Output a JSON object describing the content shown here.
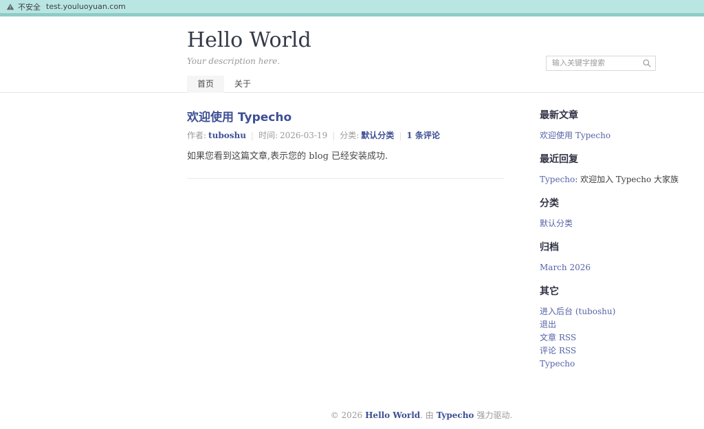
{
  "browser": {
    "security_label": "不安全",
    "url": "test.youluoyuan.com"
  },
  "header": {
    "site_title": "Hello World",
    "description": "Your description here.",
    "nav_items": [
      "首页",
      "关于"
    ],
    "search_placeholder": "输入关键字搜索"
  },
  "post": {
    "title": "欢迎使用 Typecho",
    "author_label": "作者:",
    "author": "tuboshu",
    "time_label": "时间:",
    "date": "2026-03-19",
    "category_label": "分类:",
    "category": "默认分类",
    "comments": "1 条评论",
    "separator": "|",
    "body": "如果您看到这篇文章,表示您的 blog 已经安装成功."
  },
  "sidebar": {
    "latest_posts": {
      "title": "最新文章",
      "items": [
        "欢迎使用 Typecho"
      ]
    },
    "recent_replies": {
      "title": "最近回复",
      "author": "Typecho",
      "excerpt": ": 欢迎加入 Typecho 大家族"
    },
    "categories": {
      "title": "分类",
      "items": [
        "默认分类"
      ]
    },
    "archives": {
      "title": "归档",
      "items": [
        "March 2026"
      ]
    },
    "misc": {
      "title": "其它",
      "items": [
        "进入后台 (tuboshu)",
        "退出",
        "文章 RSS",
        "评论 RSS",
        "Typecho"
      ]
    }
  },
  "footer": {
    "copyright": "© 2026",
    "site_name": "Hello World",
    "powered_prefix": ". 由",
    "engine": "Typecho",
    "powered_suffix": "强力驱动."
  },
  "colors": {
    "topbar-bg": "#b9e5e2",
    "topbar-strip": "#8fcbc7",
    "accent": "#3d4f95",
    "link": "#5663a7",
    "heading": "#343848",
    "text": "#474747",
    "muted": "#9a9a9a",
    "border": "#e4e4e4",
    "tab-bg": "#f5f5f5"
  }
}
